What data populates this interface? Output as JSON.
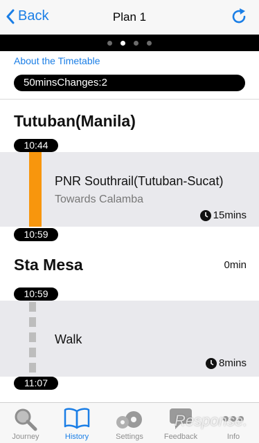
{
  "navbar": {
    "back_label": "Back",
    "title": "Plan 1"
  },
  "pager": {
    "count": 4,
    "active_index": 1
  },
  "about_link": "About the Timetable",
  "summary": {
    "duration": "50mins",
    "changes": "Changes:2"
  },
  "stations": [
    {
      "name": "Tutuban(Manila)",
      "time": ""
    },
    {
      "name": "Sta Mesa",
      "time": "0min"
    }
  ],
  "times": [
    "10:44",
    "10:59",
    "10:59",
    "11:07"
  ],
  "segments": [
    {
      "type": "train",
      "line": "PNR Southrail(Tutuban-Sucat)",
      "direction": "Towards Calamba",
      "duration": "15mins",
      "color": "#f8960d"
    },
    {
      "type": "walk",
      "line": "Walk",
      "duration": "8mins"
    }
  ],
  "tabbar": {
    "tabs": [
      {
        "label": "Journey",
        "icon": "magnifier-icon"
      },
      {
        "label": "History",
        "icon": "book-icon",
        "active": true
      },
      {
        "label": "Settings",
        "icon": "gears-icon"
      },
      {
        "label": "Feedback",
        "icon": "speech-bubble-icon"
      },
      {
        "label": "Info",
        "icon": "more-dots-icon"
      }
    ]
  },
  "watermark": "Response."
}
